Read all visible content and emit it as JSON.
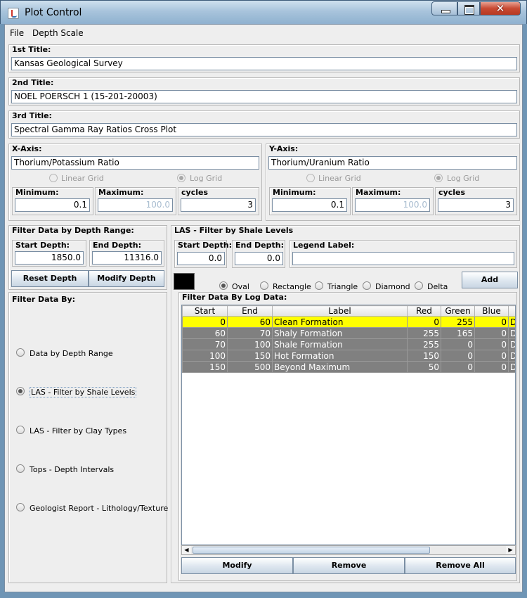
{
  "window": {
    "title": "Plot Control"
  },
  "menu": {
    "file": "File",
    "depth_scale": "Depth Scale"
  },
  "titles": {
    "first_label": "1st Title:",
    "first_value": "Kansas Geological Survey",
    "second_label": "2nd Title:",
    "second_value": "NOEL POERSCH 1 (15-201-20003)",
    "third_label": "3rd Title:",
    "third_value": "Spectral Gamma Ray Ratios Cross Plot"
  },
  "xaxis": {
    "label": "X-Axis:",
    "title_value": "Thorium/Potassium Ratio",
    "linear_grid": "Linear Grid",
    "log_grid": "Log Grid",
    "min_label": "Minimum:",
    "min_value": "0.1",
    "max_label": "Maximum:",
    "max_value": "100.0",
    "cycles_label": "cycles",
    "cycles_value": "3"
  },
  "yaxis": {
    "label": "Y-Axis:",
    "title_value": "Thorium/Uranium Ratio",
    "linear_grid": "Linear Grid",
    "log_grid": "Log Grid",
    "min_label": "Minimum:",
    "min_value": "0.1",
    "max_label": "Maximum:",
    "max_value": "100.0",
    "cycles_label": "cycles",
    "cycles_value": "3"
  },
  "depth_filter": {
    "label": "Filter Data by Depth Range:",
    "start_label": "Start Depth:",
    "start_value": "1850.0",
    "end_label": "End Depth:",
    "end_value": "11316.0",
    "reset_button": "Reset Depth",
    "modify_button": "Modify Depth"
  },
  "filter_by": {
    "label": "Filter Data By:",
    "options": [
      "Data by Depth Range",
      "LAS - Filter by Shale Levels",
      "LAS - Filter by Clay Types",
      "Tops - Depth Intervals",
      "Geologist Report - Lithology/Texture"
    ],
    "selected_index": 1
  },
  "las_filter": {
    "label": "LAS - Filter by Shale Levels",
    "start_label": "Start Depth:",
    "start_value": "0.0",
    "end_label": "End Depth:",
    "end_value": "0.0",
    "legend_label": "Legend Label:",
    "legend_value": "",
    "swatch_color": "#000000",
    "shapes": [
      "Oval",
      "Rectangle",
      "Triangle",
      "Diamond",
      "Delta"
    ],
    "selected_shape": "Oval",
    "add_button": "Add",
    "log_data_label": "Filter Data By Log Data:",
    "columns": [
      "Start",
      "End",
      "Label",
      "Red",
      "Green",
      "Blue",
      ""
    ],
    "rows": [
      {
        "start": "0",
        "end": "60",
        "label": "Clean Formation",
        "red": "0",
        "green": "255",
        "blue": "0",
        "extra": "D",
        "selected": true
      },
      {
        "start": "60",
        "end": "70",
        "label": "Shaly Formation",
        "red": "255",
        "green": "165",
        "blue": "0",
        "extra": "D",
        "selected": false
      },
      {
        "start": "70",
        "end": "100",
        "label": "Shale Formation",
        "red": "255",
        "green": "0",
        "blue": "0",
        "extra": "D",
        "selected": false
      },
      {
        "start": "100",
        "end": "150",
        "label": "Hot Formation",
        "red": "150",
        "green": "0",
        "blue": "0",
        "extra": "D",
        "selected": false
      },
      {
        "start": "150",
        "end": "500",
        "label": "Beyond Maximum",
        "red": "50",
        "green": "0",
        "blue": "0",
        "extra": "D",
        "selected": false
      }
    ],
    "modify_button": "Modify",
    "remove_button": "Remove",
    "remove_all_button": "Remove All"
  },
  "colors": {
    "selected_row": "#ffff00",
    "row_gray": "#808080"
  }
}
